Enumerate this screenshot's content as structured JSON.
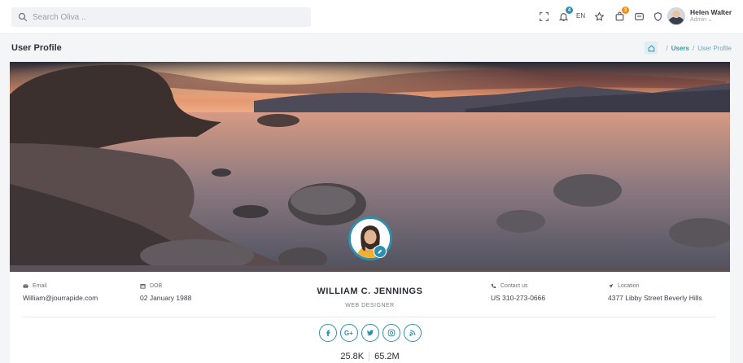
{
  "search": {
    "placeholder": "Search Oliva .."
  },
  "topbar": {
    "notifications_badge": "4",
    "cart_badge": "3",
    "language": "EN",
    "badge_colors": {
      "notifications": "#2d8fb0",
      "cart": "#f08c1a"
    }
  },
  "user": {
    "name": "Helen Walter",
    "role": "Admin"
  },
  "page": {
    "title": "User Profile"
  },
  "breadcrumb": {
    "users": "Users",
    "current": "User Profile"
  },
  "profile": {
    "name": "WILLIAM C. JENNINGS",
    "title": "WEB DESIGNER",
    "email_label": "Email",
    "email": "William@jourrapide.com",
    "dob_label": "DOB",
    "dob": "02 January 1988",
    "contact_label": "Contact us",
    "contact": "US 310-273-0666",
    "location_label": "Location",
    "location": "4377 Libby Street Beverly Hills"
  },
  "socials": [
    "facebook-icon",
    "google-plus-icon",
    "twitter-icon",
    "instagram-icon",
    "rss-icon"
  ],
  "social_labels": {
    "google_plus": "G+"
  },
  "stats": {
    "first": "25.8K",
    "second": "65.2M"
  },
  "colors": {
    "accent": "#2d8fb0",
    "page_bg": "#f4f5f7"
  }
}
